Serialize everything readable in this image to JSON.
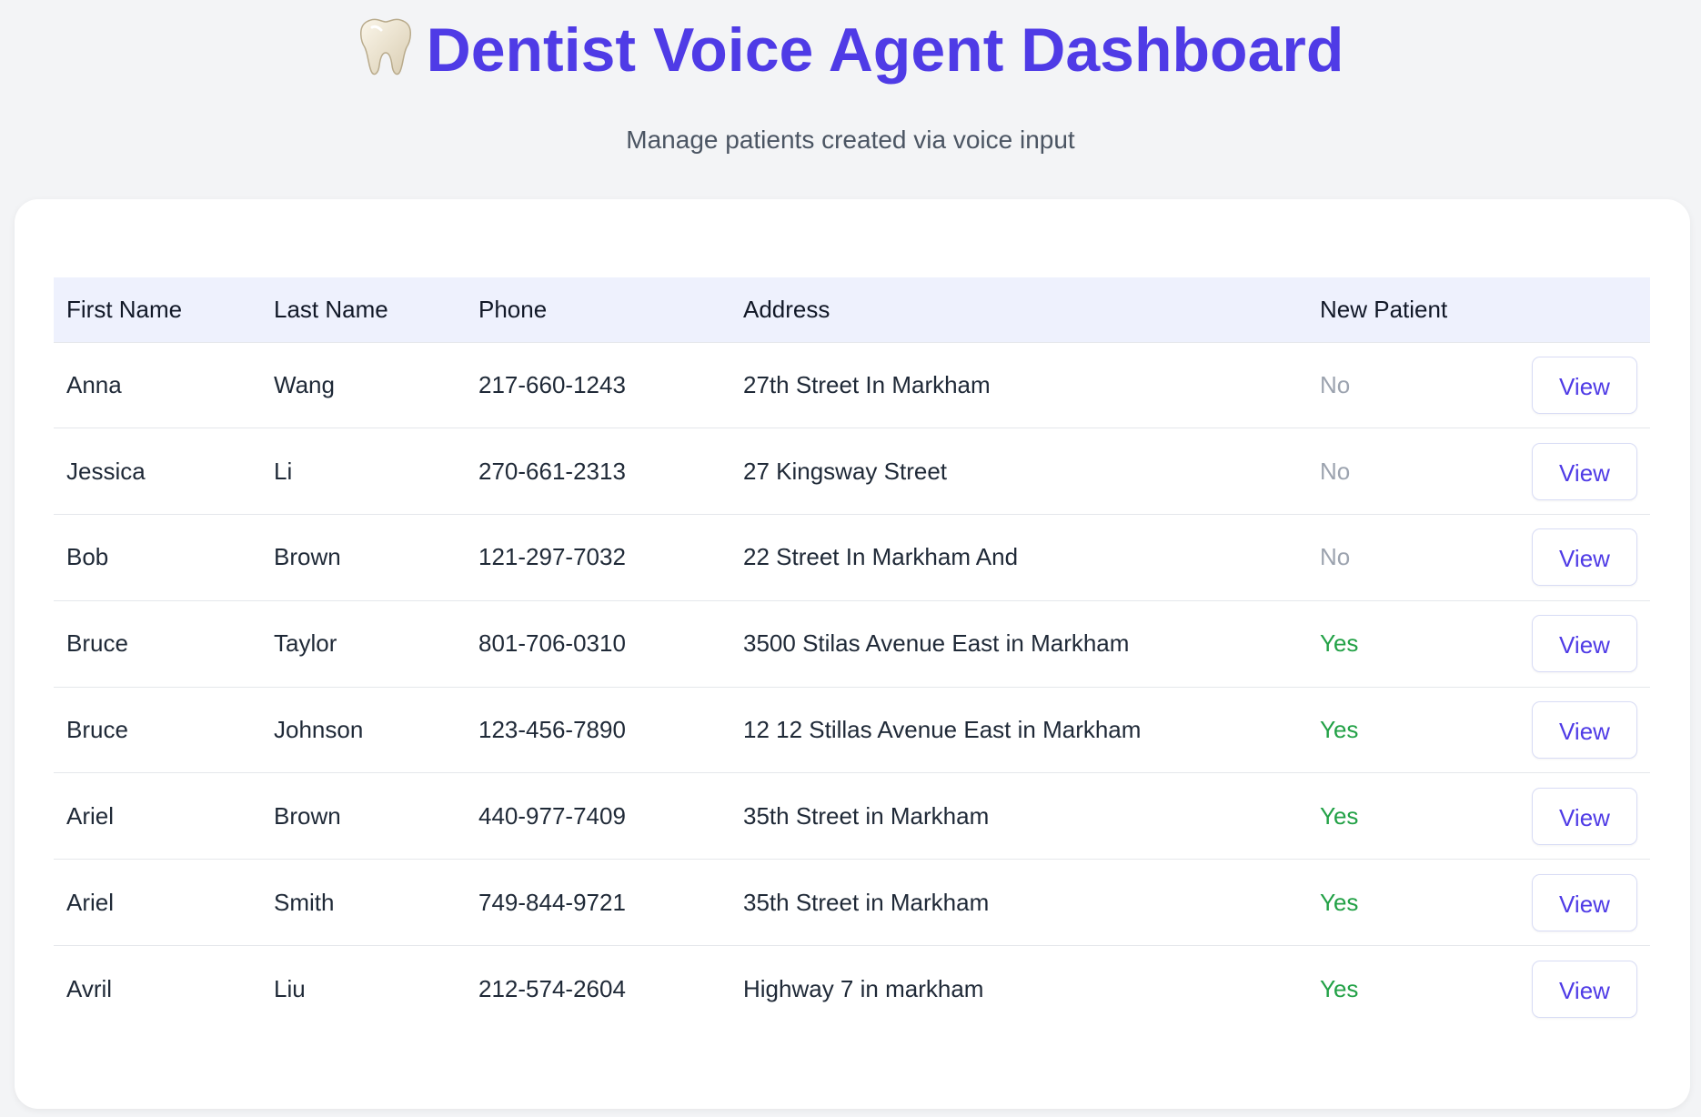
{
  "header": {
    "title": "Dentist Voice Agent Dashboard",
    "subtitle": "Manage patients created via voice input",
    "title_color": "#4f3be6",
    "icon": "tooth-icon"
  },
  "table": {
    "columns": [
      "First Name",
      "Last Name",
      "Phone",
      "Address",
      "New Patient",
      ""
    ],
    "view_label": "View",
    "rows": [
      {
        "first": "Anna",
        "last": "Wang",
        "phone": "217-660-1243",
        "address": "27th Street In Markham",
        "new_patient": "No"
      },
      {
        "first": "Jessica",
        "last": "Li",
        "phone": "270-661-2313",
        "address": "27 Kingsway Street",
        "new_patient": "No"
      },
      {
        "first": "Bob",
        "last": "Brown",
        "phone": "121-297-7032",
        "address": "22 Street In Markham And",
        "new_patient": "No"
      },
      {
        "first": "Bruce",
        "last": "Taylor",
        "phone": "801-706-0310",
        "address": "3500 Stilas Avenue East in Markham",
        "new_patient": "Yes"
      },
      {
        "first": "Bruce",
        "last": "Johnson",
        "phone": "123-456-7890",
        "address": "12 12 Stillas Avenue East in Markham",
        "new_patient": "Yes"
      },
      {
        "first": "Ariel",
        "last": "Brown",
        "phone": "440-977-7409",
        "address": "35th Street in Markham",
        "new_patient": "Yes"
      },
      {
        "first": "Ariel",
        "last": "Smith",
        "phone": "749-844-9721",
        "address": "35th Street in Markham",
        "new_patient": "Yes"
      },
      {
        "first": "Avril",
        "last": "Liu",
        "phone": "212-574-2604",
        "address": "Highway 7 in markham",
        "new_patient": "Yes"
      }
    ]
  },
  "colors": {
    "yes": "#22a146",
    "no": "#9ca3af",
    "header_bg": "#eef1fd",
    "accent": "#4f3be6"
  }
}
